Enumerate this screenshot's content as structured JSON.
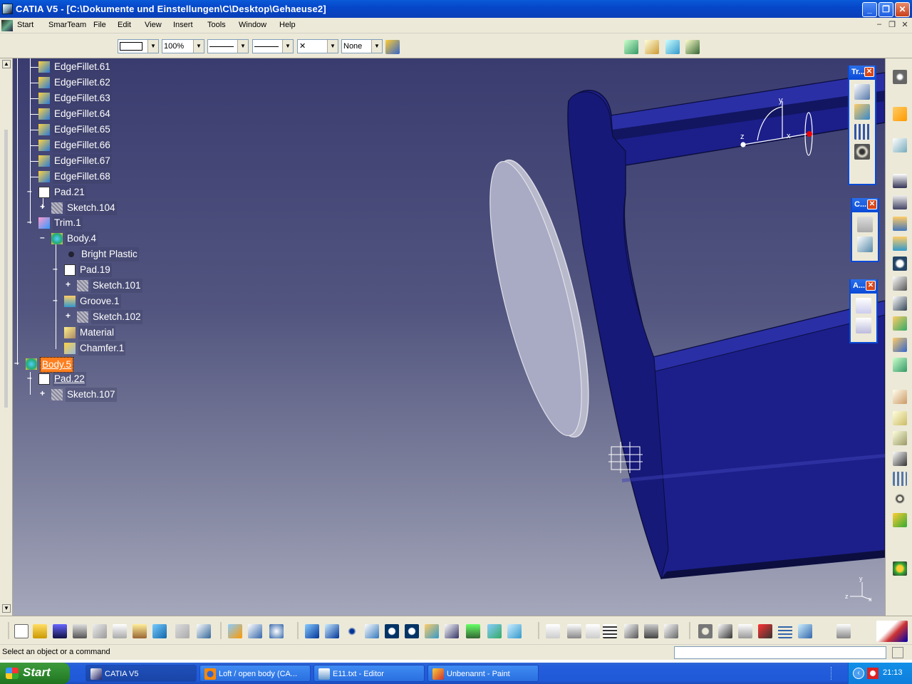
{
  "window": {
    "title": "CATIA V5 - [C:\\Dokumente und Einstellungen\\C\\Desktop\\Gehaeuse2]",
    "minimize": "_",
    "maximize": "❐",
    "close": "✕"
  },
  "menu": {
    "items": [
      "Start",
      "SmarTeam",
      "File",
      "Edit",
      "View",
      "Insert",
      "Tools",
      "Window",
      "Help"
    ]
  },
  "properties_bar": {
    "zoom": "100%",
    "style": "None"
  },
  "tree": {
    "nodes": [
      "EdgeFillet.61",
      "EdgeFillet.62",
      "EdgeFillet.63",
      "EdgeFillet.64",
      "EdgeFillet.65",
      "EdgeFillet.66",
      "EdgeFillet.67",
      "EdgeFillet.68",
      "Pad.21",
      "Sketch.104",
      "Trim.1",
      "Body.4",
      "Bright Plastic",
      "Pad.19",
      "Sketch.101",
      "Groove.1",
      "Sketch.102",
      "Material",
      "Chamfer.1",
      "Body.5",
      "Pad.22",
      "Sketch.107"
    ]
  },
  "toolboxes": [
    {
      "title": "Tr..."
    },
    {
      "title": "C..."
    },
    {
      "title": "A..."
    }
  ],
  "status": {
    "message": "Select an object or a command"
  },
  "taskbar": {
    "start": "Start",
    "tasks": [
      "CATIA V5",
      "Loft / open body (CA...",
      "E11.txt - Editor",
      "Unbenannt - Paint"
    ],
    "clock": "21:13"
  },
  "compass_axes": {
    "x": "x",
    "y": "y",
    "z": "z"
  },
  "colors": {
    "accent": "#0a4ad8",
    "selection": "#ff7f1f",
    "viewport_top": "#3a3c70"
  }
}
